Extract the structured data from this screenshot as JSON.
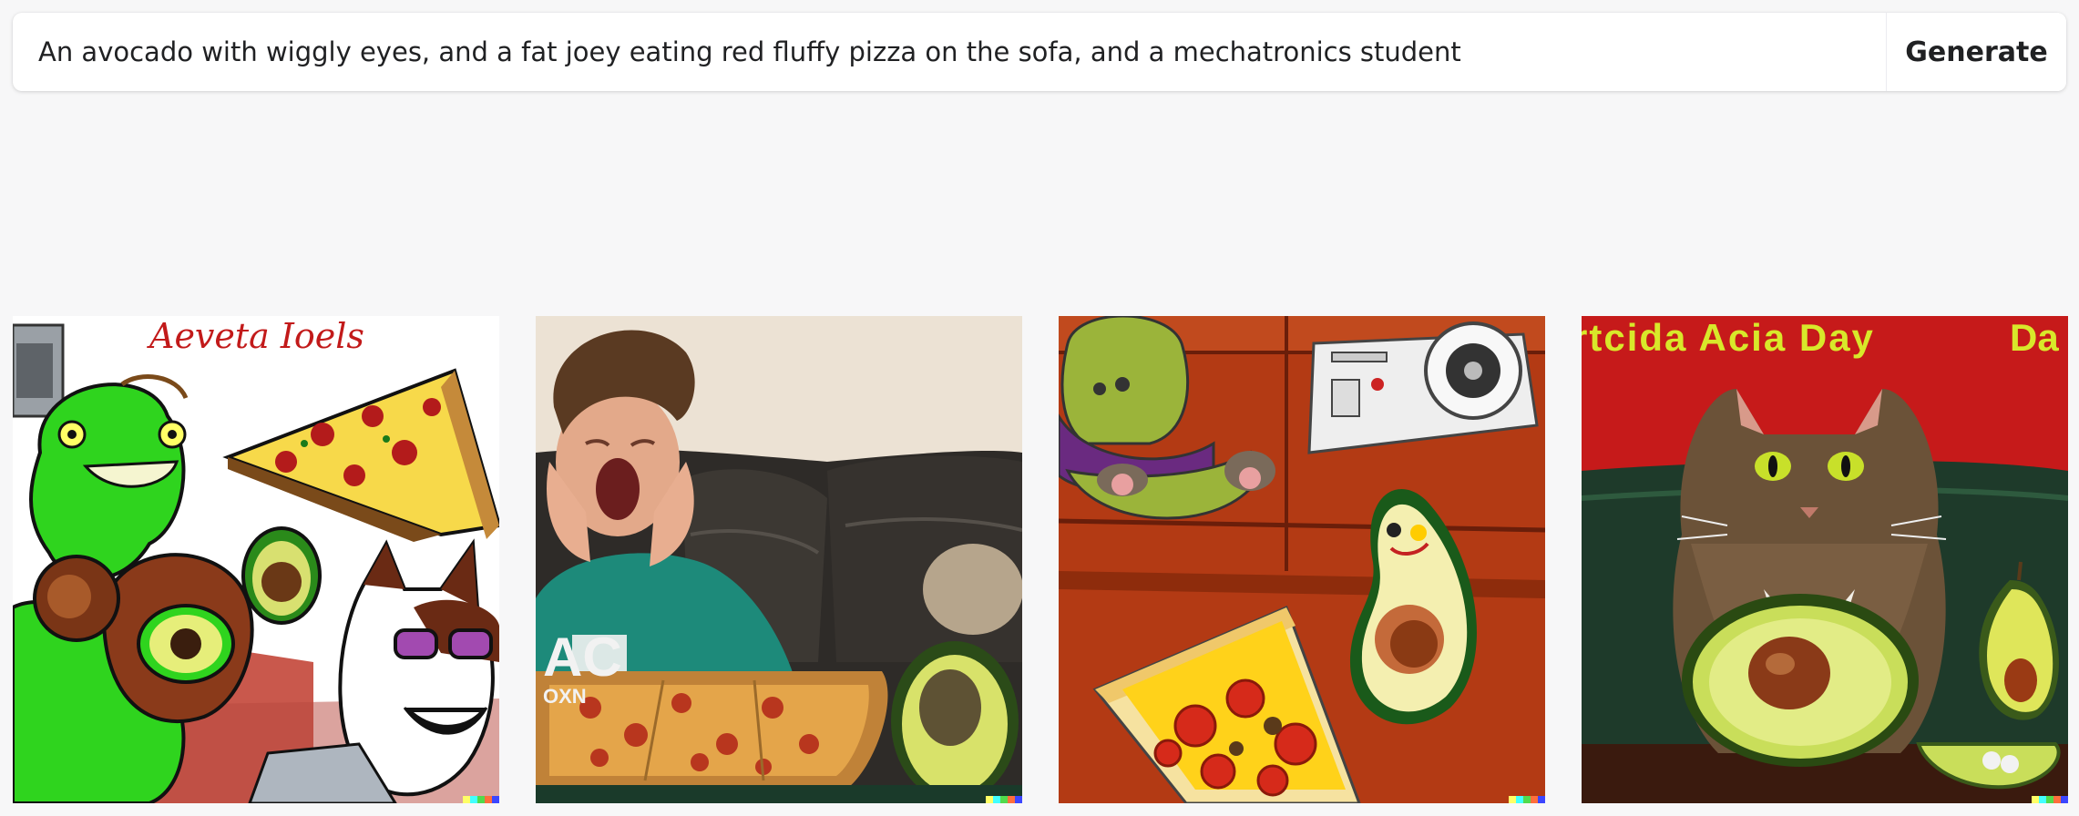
{
  "prompt": {
    "value": "An avocado with wiggly eyes, and a fat joey eating red fluffy pizza on the sofa, and a mechatronics student",
    "button_label": "Generate"
  },
  "images": [
    {
      "overlay_text": "Aeveta Ioels"
    },
    {
      "overlay_text": "AC",
      "overlay_text_2": "OXN"
    },
    {
      "overlay_text": ""
    },
    {
      "overlay_text": "rtcida Acia Day",
      "overlay_text_2": "Da"
    }
  ],
  "watermark_colors": [
    "#ffff66",
    "#42ffff",
    "#51da4c",
    "#ff6e3c",
    "#3c46ff"
  ]
}
